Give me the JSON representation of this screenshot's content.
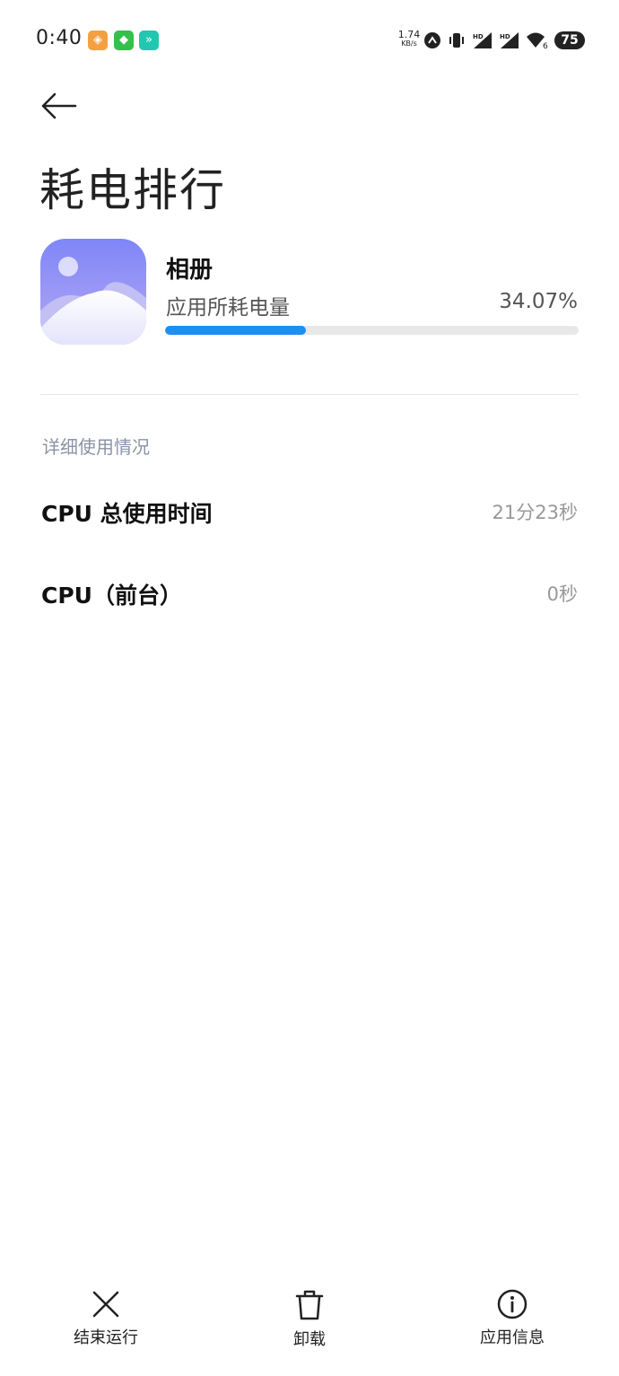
{
  "status_bar": {
    "time": "0:40",
    "net_speed_value": "1.74",
    "net_speed_unit": "KB/s",
    "battery_level": "75",
    "wifi_badge": "6"
  },
  "header": {
    "title": "耗电排行"
  },
  "app": {
    "name": "相册",
    "usage_label": "应用所耗电量",
    "usage_percent_text": "34.07%",
    "usage_fraction": 0.3407,
    "accent_color": "#1e8ef0"
  },
  "details": {
    "section_title": "详细使用情况",
    "rows": [
      {
        "label": "CPU 总使用时间",
        "value": "21分23秒"
      },
      {
        "label": "CPU（前台）",
        "value": "0秒"
      }
    ]
  },
  "bottom_bar": {
    "stop_label": "结束运行",
    "uninstall_label": "卸载",
    "info_label": "应用信息"
  },
  "icons": {
    "back": "arrow-left-icon",
    "stop": "close-icon",
    "uninstall": "trash-icon",
    "info": "info-icon"
  }
}
